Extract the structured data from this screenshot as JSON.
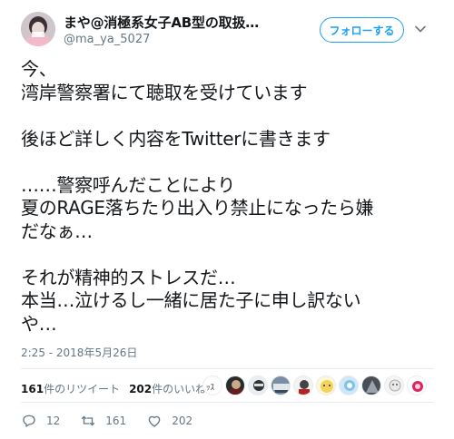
{
  "user": {
    "display_name": "まや@消極系女子AB型の取扱…",
    "handle": "@ma_ya_5027"
  },
  "follow_button": {
    "label": "フォローする"
  },
  "tweet": {
    "lines": [
      "今、",
      "湾岸警察署にて聴取を受けています",
      "",
      "後ほど詳しく内容をTwitterに書きます",
      "",
      "……警察呼んだことにより",
      "夏のRAGE落ちたり出入り禁止になったら嫌",
      "だなぁ…",
      "",
      "それが精神的ストレスだ…",
      "本当…泣けるし一緒に居た子に申し訳ない",
      "や…"
    ],
    "timestamp": "2:25 - 2018年5月26日"
  },
  "stats": {
    "retweets_count": "161",
    "retweets_label": "件のリツイート",
    "likes_count": "202",
    "likes_label": "件のいいね"
  },
  "actions": {
    "reply_count": "12",
    "retweet_count": "161",
    "like_count": "202"
  },
  "icons": {
    "follow": "follow-button",
    "caret": "chevron-down-icon",
    "reply": "reply-icon",
    "retweet": "retweet-icon",
    "like": "heart-icon"
  },
  "colors": {
    "accent": "#1da1f2",
    "text": "#14171a",
    "secondary": "#657786",
    "divider": "#e6ecf0"
  }
}
